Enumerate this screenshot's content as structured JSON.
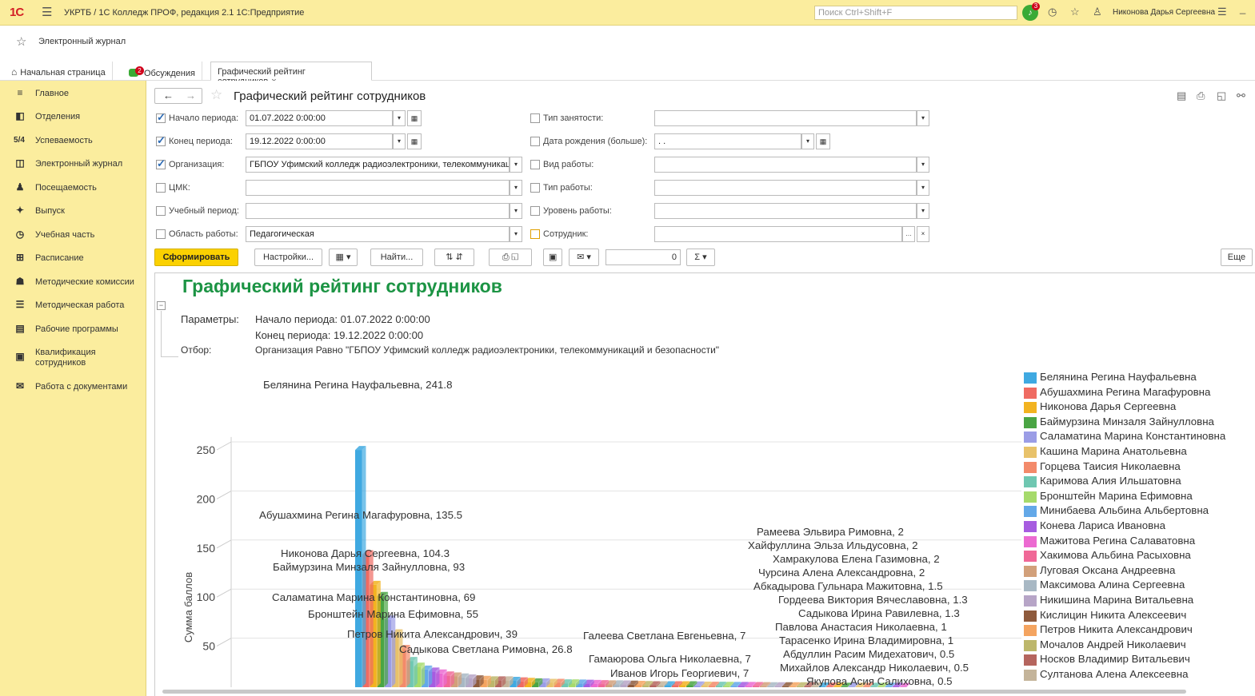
{
  "app": {
    "title": "УКРТБ / 1С Колледж ПРОФ, редакция 2.1 1С:Предприятие",
    "search_placeholder": "Поиск Ctrl+Shift+F",
    "notifications": "3",
    "user": "Никонова Дарья Сергеевна"
  },
  "favorites": {
    "label": "Электронный журнал"
  },
  "tabs": {
    "home": "Начальная страница",
    "discussions": "Обсуждения",
    "discussions_badge": "2",
    "active": "Графический рейтинг сотрудников"
  },
  "sidebar": [
    {
      "icon": "≡",
      "label": "Главное"
    },
    {
      "icon": "◧",
      "label": "Отделения"
    },
    {
      "icon": "5/4",
      "label": "Успеваемость"
    },
    {
      "icon": "◫",
      "label": "Электронный журнал"
    },
    {
      "icon": "♟",
      "label": "Посещаемость"
    },
    {
      "icon": "✦",
      "label": "Выпуск"
    },
    {
      "icon": "◷",
      "label": "Учебная часть"
    },
    {
      "icon": "⊞",
      "label": "Расписание"
    },
    {
      "icon": "☗",
      "label": "Методические комиссии"
    },
    {
      "icon": "☰",
      "label": "Методическая работа"
    },
    {
      "icon": "▤",
      "label": "Рабочие программы"
    },
    {
      "icon": "▣",
      "label": "Квалификация сотрудников"
    },
    {
      "icon": "✉",
      "label": "Работа с документами"
    }
  ],
  "form": {
    "title": "Графический рейтинг сотрудников",
    "left": [
      {
        "label": "Начало периода:",
        "checked": true,
        "value": "01.07.2022  0:00:00"
      },
      {
        "label": "Конец периода:",
        "checked": true,
        "value": "19.12.2022  0:00:00"
      },
      {
        "label": "Организация:",
        "checked": true,
        "value": "ГБПОУ Уфимский колледж радиоэлектроники, телекоммуникац"
      },
      {
        "label": "ЦМК:",
        "checked": false,
        "value": ""
      },
      {
        "label": "Учебный период:",
        "checked": false,
        "value": ""
      },
      {
        "label": "Область работы:",
        "checked": false,
        "value": "Педагогическая"
      }
    ],
    "right": [
      {
        "label": "Тип занятости:",
        "checked": false,
        "value": ""
      },
      {
        "label": "Дата рождения (больше):",
        "checked": false,
        "value": " .  ."
      },
      {
        "label": "Вид работы:",
        "checked": false,
        "value": ""
      },
      {
        "label": "Тип работы:",
        "checked": false,
        "value": ""
      },
      {
        "label": "Уровень работы:",
        "checked": false,
        "value": ""
      },
      {
        "label": "Сотрудник:",
        "checked": false,
        "value": ""
      }
    ],
    "buttons": {
      "generate": "Сформировать",
      "settings": "Настройки...",
      "find": "Найти...",
      "sum_value": "0",
      "more": "Еще"
    }
  },
  "report": {
    "title": "Графический рейтинг сотрудников",
    "params_label": "Параметры:",
    "param1": "Начало периода: 01.07.2022 0:00:00",
    "param2": "Конец периода: 19.12.2022 0:00:00",
    "filter_label": "Отбор:",
    "filter": "Организация Равно \"ГБПОУ Уфимский колледж радиоэлектроники, телекоммуникаций и безопасности\""
  },
  "chart_data": {
    "type": "bar",
    "ylabel": "Сумма баллов",
    "yticks": [
      50,
      100,
      150,
      200,
      250
    ],
    "ylim": [
      0,
      250
    ],
    "grid": true,
    "legend_position": "right",
    "series": [
      {
        "name": "Белянина Регина Науфальевна",
        "value": 241.8,
        "color": "#3fa9e1"
      },
      {
        "name": "Абушахмина Регина Магафуровна",
        "value": 135.5,
        "color": "#ef6b62"
      },
      {
        "name": "Никонова Дарья Сергеевна",
        "value": 104.3,
        "color": "#f2b320"
      },
      {
        "name": "Баймурзина Минзаля Зайнулловна",
        "value": 93,
        "color": "#4aa544"
      },
      {
        "name": "Саламатина Марина Константиновна",
        "value": 69,
        "color": "#9b9de6"
      },
      {
        "name": "Кашина Марина Анатольевна",
        "value": 0,
        "color": "#e8c26a"
      },
      {
        "name": "Горцева Таисия Николаевна",
        "value": 0,
        "color": "#f38a6a"
      },
      {
        "name": "Каримова  Алия Ильшатовна",
        "value": 0,
        "color": "#6fc7b1"
      },
      {
        "name": "Бронштейн Марина Ефимовна",
        "value": 55,
        "color": "#a6da6b"
      },
      {
        "name": "Минибаева Альбина Альбертовна",
        "value": 0,
        "color": "#63a8e8"
      },
      {
        "name": "Конева Лариса Ивановна",
        "value": 0,
        "color": "#a65ce0"
      },
      {
        "name": "Мажитова Регина Салаватовна",
        "value": 0,
        "color": "#ec6ad1"
      },
      {
        "name": "Хакимова Альбина Расыховна",
        "value": 0,
        "color": "#f06897"
      },
      {
        "name": "Луговая Оксана Андреевна",
        "value": 0,
        "color": "#d2a07a"
      },
      {
        "name": "Максимова Алина Сергеевна",
        "value": 0,
        "color": "#a8b8c4"
      },
      {
        "name": "Никишина Марина Витальевна",
        "value": 0,
        "color": "#b7a5c7"
      },
      {
        "name": "Кислицин Никита Алексеевич",
        "value": 0,
        "color": "#8e5a3c"
      },
      {
        "name": "Петров Никита Александрович",
        "value": 39,
        "color": "#f4a460"
      },
      {
        "name": "Мочалов Андрей Николаевич",
        "value": 0,
        "color": "#bdb76b"
      },
      {
        "name": "Носков Владимир Витальевич",
        "value": 0,
        "color": "#b5655e"
      },
      {
        "name": "Султанова Алена Алексеевна",
        "value": 0,
        "color": "#c4b49a"
      }
    ],
    "labels": [
      "Белянина Регина Науфальевна, 241.8",
      "Абушахмина Регина Магафуровна, 135.5",
      "Никонова Дарья Сергеевна, 104.3",
      "Баймурзина Минзаля Зайнулловна, 93",
      "Саламатина Марина Константиновна, 69",
      "Бронштейн Марина Ефимовна, 55",
      "Петров Никита Александрович, 39",
      "Садыкова Светлана Римовна, 26.8",
      "Галеева Светлана Евгеньевна, 7",
      "Гамаюрова Ольга Николаевна, 7",
      "Иванов Игорь Георгиевич, 7",
      "Рамеева Эльвира Римовна, 2",
      "Хайфуллина Эльза Ильдусовна, 2",
      "Хамракулова Елена Газимовна, 2",
      "Чурсина Алена Александровна, 2",
      "Абкадырова Гульнара Мажитовна, 1.5",
      "Гордеева Виктория Вячеславовна, 1.3",
      "Садыкова Ирина Равилевна, 1.3",
      "Павлова Анастасия Николаевна, 1",
      "Тарасенко Ирина Владимировна, 1",
      "Абдуллин Расим Мидехатович, 0.5",
      "Михайлов Александр Николаевич, 0.5",
      "Якупова Асия Салиховна, 0.5"
    ]
  }
}
